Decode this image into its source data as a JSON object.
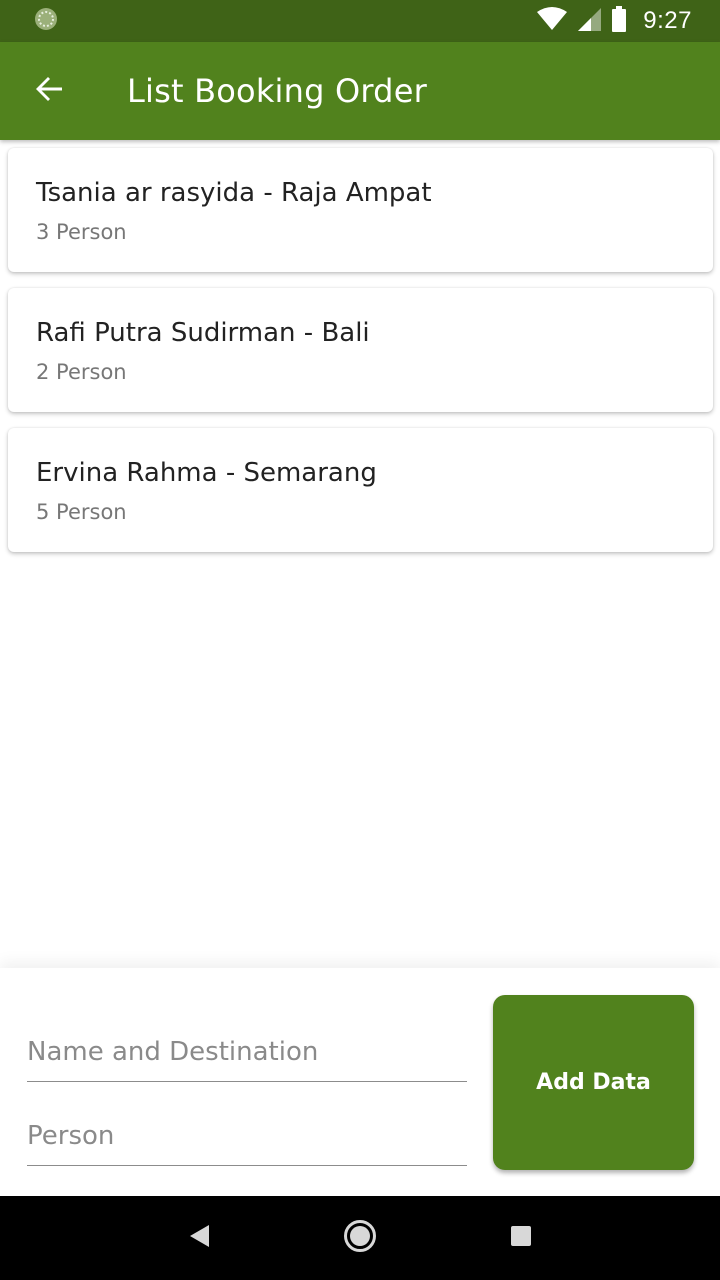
{
  "status_bar": {
    "time": "9:27",
    "icons": [
      "app-notification-icon",
      "wifi-icon",
      "signal-icon",
      "battery-icon"
    ]
  },
  "app_bar": {
    "title": "List Booking Order",
    "back_icon": "arrow-back-icon"
  },
  "bookings": [
    {
      "title": "Tsania ar rasyida - Raja Ampat",
      "subtitle": "3 Person"
    },
    {
      "title": "Rafi Putra Sudirman - Bali",
      "subtitle": "2 Person"
    },
    {
      "title": "Ervina Rahma - Semarang",
      "subtitle": "5 Person"
    }
  ],
  "form": {
    "name_placeholder": "Name and Destination",
    "person_placeholder": "Person",
    "add_label": "Add Data"
  },
  "nav_bar": {
    "icons": [
      "back-triangle-icon",
      "home-circle-icon",
      "recents-square-icon"
    ]
  },
  "colors": {
    "status_bar": "#3f6317",
    "primary": "#51821d"
  }
}
